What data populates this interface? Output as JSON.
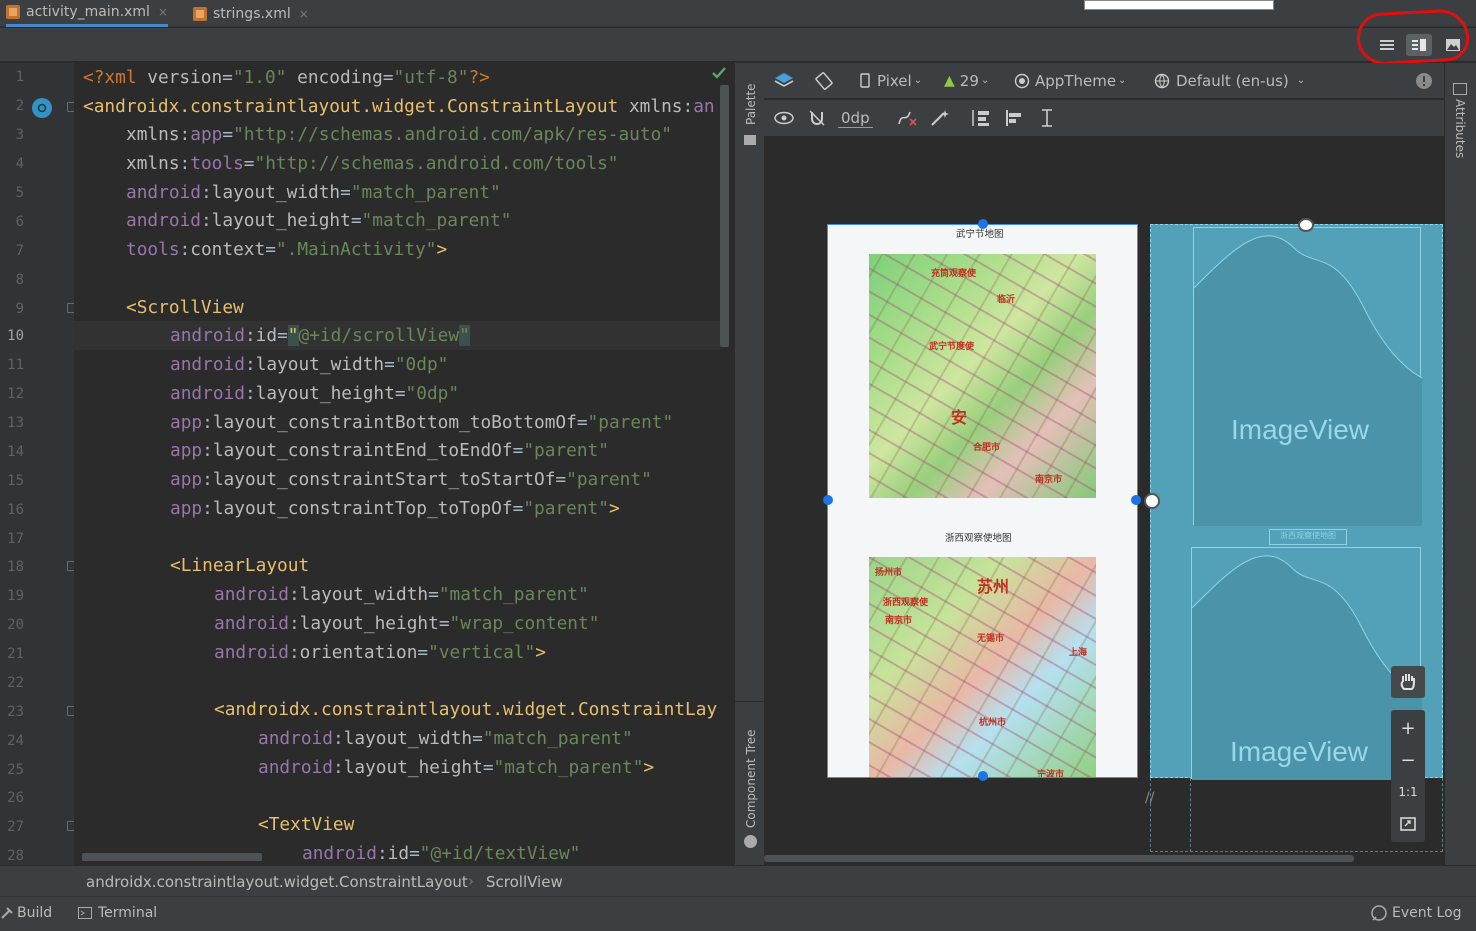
{
  "tabs": [
    {
      "label": "activity_main.xml",
      "close": "×"
    },
    {
      "label": "strings.xml",
      "close": "×"
    }
  ],
  "line_numbers": [
    "1",
    "2",
    "3",
    "4",
    "5",
    "6",
    "7",
    "8",
    "9",
    "10",
    "11",
    "12",
    "13",
    "14",
    "15",
    "16",
    "17",
    "18",
    "19",
    "20",
    "21",
    "22",
    "23",
    "24",
    "25",
    "26",
    "27",
    "28"
  ],
  "code": {
    "l1": [
      "<?xml ",
      "version",
      "=",
      "\"1.0\"",
      " encoding",
      "=",
      "\"utf-8\"",
      "?>"
    ],
    "l2": [
      "<androidx.constraintlayout.widget.ConstraintLayout ",
      "xmlns",
      ":",
      "an"
    ],
    "l3": [
      "xmlns",
      ":",
      "app",
      "=",
      "\"http://schemas.android.com/apk/res-auto\""
    ],
    "l4": [
      "xmlns",
      ":",
      "tools",
      "=",
      "\"http://schemas.android.com/tools\""
    ],
    "l5": [
      "android",
      ":",
      "layout_width",
      "=",
      "\"match_parent\""
    ],
    "l6": [
      "android",
      ":",
      "layout_height",
      "=",
      "\"match_parent\""
    ],
    "l7": [
      "tools",
      ":",
      "context",
      "=",
      "\".MainActivity\"",
      ">"
    ],
    "l9": [
      "<ScrollView"
    ],
    "l10": [
      "android",
      ":",
      "id",
      "=",
      "\"",
      "@+id/scrollView",
      "\""
    ],
    "l11": [
      "android",
      ":",
      "layout_width",
      "=",
      "\"0dp\""
    ],
    "l12": [
      "android",
      ":",
      "layout_height",
      "=",
      "\"0dp\""
    ],
    "l13": [
      "app",
      ":",
      "layout_constraintBottom_toBottomOf",
      "=",
      "\"parent\""
    ],
    "l14": [
      "app",
      ":",
      "layout_constraintEnd_toEndOf",
      "=",
      "\"parent\""
    ],
    "l15": [
      "app",
      ":",
      "layout_constraintStart_toStartOf",
      "=",
      "\"parent\""
    ],
    "l16": [
      "app",
      ":",
      "layout_constraintTop_toTopOf",
      "=",
      "\"parent\"",
      ">"
    ],
    "l18": [
      "<LinearLayout"
    ],
    "l19": [
      "android",
      ":",
      "layout_width",
      "=",
      "\"match_parent\""
    ],
    "l20": [
      "android",
      ":",
      "layout_height",
      "=",
      "\"wrap_content\""
    ],
    "l21": [
      "android",
      ":",
      "orientation",
      "=",
      "\"vertical\"",
      ">"
    ],
    "l23": [
      "<androidx.constraintlayout.widget.ConstraintLay"
    ],
    "l24": [
      "android",
      ":",
      "layout_width",
      "=",
      "\"match_parent\""
    ],
    "l25": [
      "android",
      ":",
      "layout_height",
      "=",
      "\"match_parent\"",
      ">"
    ],
    "l27": [
      "<TextView"
    ],
    "l28": [
      "android",
      ":",
      "id",
      "=",
      "\"@+id/textView\""
    ]
  },
  "sidebar": {
    "palette": "Palette",
    "component_tree": "Component Tree"
  },
  "right_sidebar": {
    "attributes": "Attributes"
  },
  "design_toolbar": {
    "device": "Pixel",
    "api": "29",
    "theme": "AppTheme",
    "locale": "Default (en-us)",
    "margin": "0dp"
  },
  "preview": {
    "title1": "武宁节地图",
    "title2": "浙西观察使地图",
    "map1_labels": [
      "充筒观察使",
      "武宁节度使",
      "安",
      "合肥市",
      "临沂",
      "南京市"
    ],
    "map2_labels": [
      "扬州市",
      "浙西观察使",
      "南京市",
      "苏州",
      "无锡市",
      "上海",
      "杭州市",
      "宁波市"
    ]
  },
  "blueprint": {
    "image_label_1": "ImageView",
    "image_label_2": "ImageView",
    "caption_2": "浙西观察使地图"
  },
  "zoom": {
    "in": "+",
    "out": "−",
    "one_to_one": "1:1"
  },
  "breadcrumb": {
    "item1": "androidx.constraintlayout.widget.ConstraintLayout",
    "sep": "›",
    "item2": "ScrollView"
  },
  "bottom": {
    "build": "Build",
    "terminal": "Terminal",
    "event_log": "Event Log"
  },
  "colors": {
    "tag": "#e8bf6a",
    "namespace": "#9876aa",
    "value": "#6a8759",
    "selection": "#3d8bff",
    "blueprint": "#52a1b8",
    "annotation": "#e01010"
  }
}
